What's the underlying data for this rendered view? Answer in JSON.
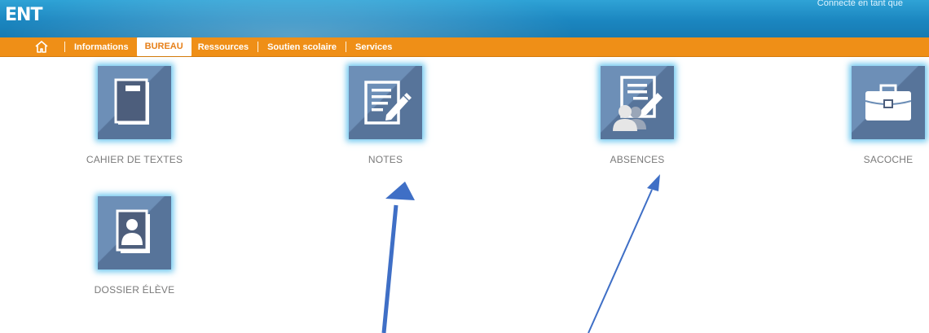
{
  "header": {
    "logo_text": "ENT",
    "user_text": "Connecté en tant que"
  },
  "menu": {
    "home_icon": "home-icon",
    "items": [
      {
        "label": "Informations",
        "active": false
      },
      {
        "label": "BUREAU",
        "active": true
      },
      {
        "label": "Ressources",
        "active": false
      },
      {
        "label": "Soutien scolaire",
        "active": false
      },
      {
        "label": "Services",
        "active": false
      }
    ]
  },
  "apps": [
    {
      "label": "CAHIER DE TEXTES",
      "icon": "notebook-icon"
    },
    {
      "label": "NOTES",
      "icon": "notes-icon"
    },
    {
      "label": "ABSENCES",
      "icon": "absences-icon"
    },
    {
      "label": "SACOCHE",
      "icon": "briefcase-icon"
    },
    {
      "label": "DOSSIER ÉLÈVE",
      "icon": "student-file-icon"
    }
  ],
  "colors": {
    "header_blue": "#1b86c0",
    "menu_orange": "#ef8f17",
    "tile": "#6d8fb7",
    "tile_glow": "#58beeb",
    "arrow": "#3f6fc6",
    "label_gray": "#7a7a7a"
  }
}
